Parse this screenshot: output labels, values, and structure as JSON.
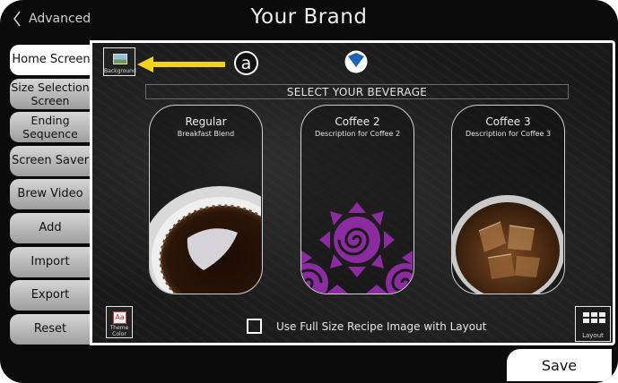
{
  "header": {
    "back_label": "Advanced",
    "title": "Your Brand"
  },
  "sidebar": {
    "items": [
      {
        "label": "Home Screen",
        "active": true
      },
      {
        "label": "Size Selection Screen"
      },
      {
        "label": "Ending Sequence"
      },
      {
        "label": "Screen Saver"
      },
      {
        "label": "Brew Video"
      },
      {
        "label": "Add"
      },
      {
        "label": "Import"
      },
      {
        "label": "Export"
      },
      {
        "label": "Reset"
      }
    ]
  },
  "main": {
    "background_button_label": "Background",
    "callout_label": "a",
    "select_title": "SELECT YOUR BEVERAGE",
    "cards": [
      {
        "name": "Regular",
        "description": "Breakfast Blend"
      },
      {
        "name": "Coffee 2",
        "description": "Description for Coffee 2"
      },
      {
        "name": "Coffee 3",
        "description": "Description for Coffee 3"
      }
    ],
    "theme_button_label": "Theme Color",
    "theme_icon_text": "Aa",
    "full_size_label": "Use Full Size Recipe Image with Layout",
    "full_size_checked": false,
    "layout_button_label": "Layout"
  },
  "footer": {
    "save_label": "Save"
  },
  "colors": {
    "arrow": "#f2d21b",
    "logo_blue": "#1f63b5",
    "pattern_purple": "#8a2ba0"
  }
}
